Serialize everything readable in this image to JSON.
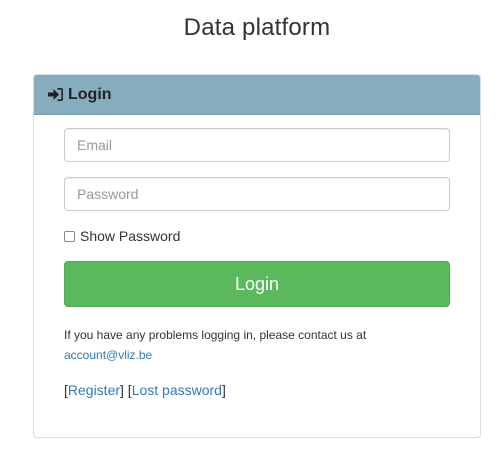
{
  "page": {
    "title": "Data platform"
  },
  "panel": {
    "heading": "Login"
  },
  "form": {
    "email_placeholder": "Email",
    "password_placeholder": "Password",
    "show_password_label": "Show Password",
    "submit_label": "Login"
  },
  "help": {
    "text": "If you have any problems logging in, please contact us at",
    "email": "account@vliz.be"
  },
  "links": {
    "register": "Register",
    "lost_password": "Lost password"
  },
  "colors": {
    "heading_bg": "#85adbd",
    "button": "#5cb85c",
    "link": "#337ab7"
  },
  "icons": {
    "heading": "sign-in-icon"
  }
}
